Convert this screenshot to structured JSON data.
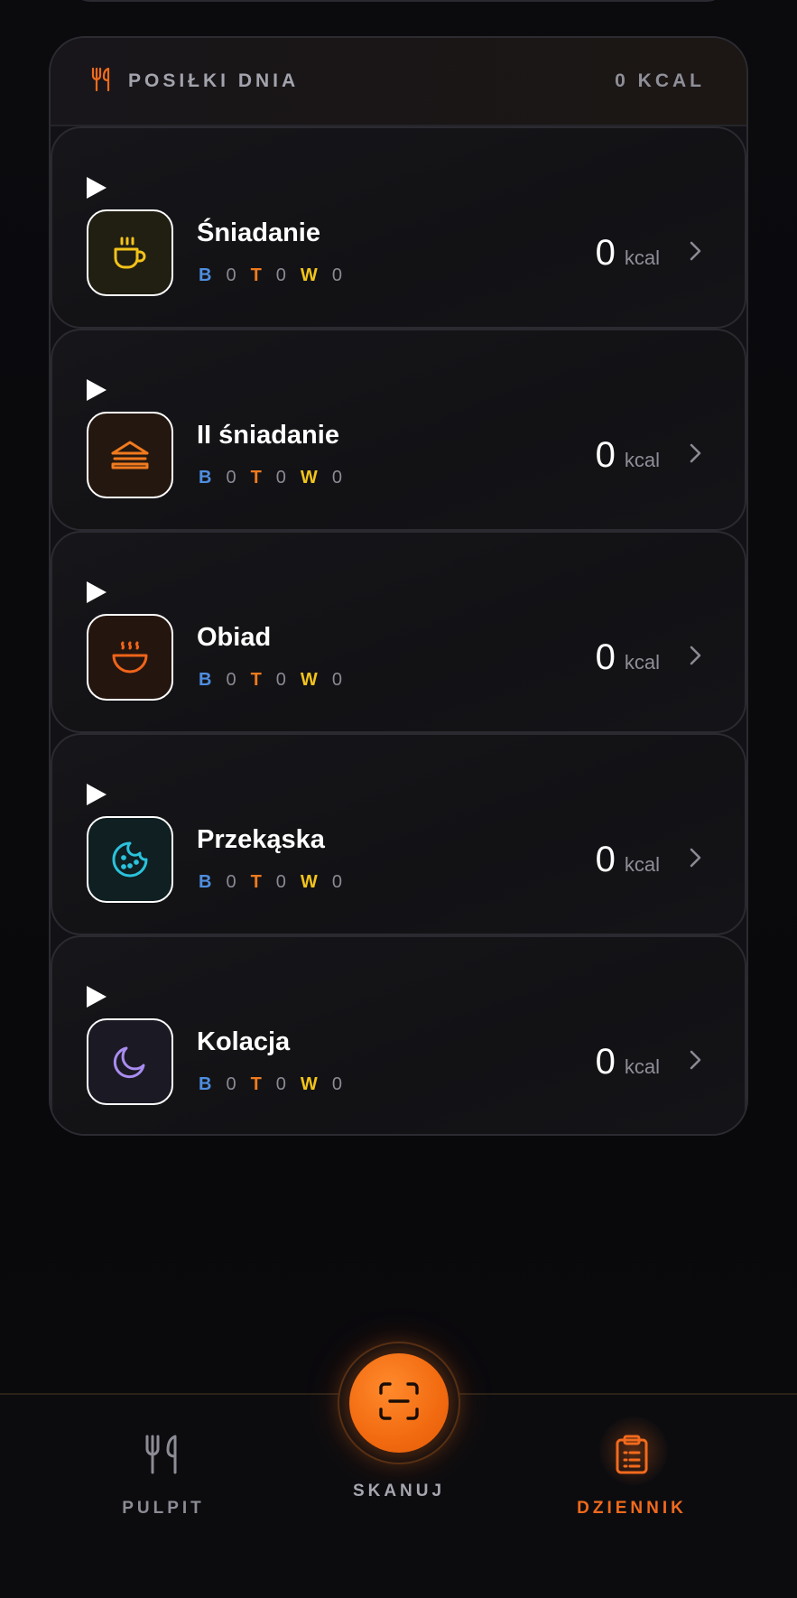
{
  "meals_section": {
    "title": "POSIŁKI DNIA",
    "total": "0 KCAL",
    "icon": "fork-knife-icon"
  },
  "meals": [
    {
      "name": "Śniadanie",
      "icon": "coffee-cup-icon",
      "kcal": "0",
      "unit": "kcal",
      "b_label": "B",
      "b": "0",
      "t_label": "T",
      "t": "0",
      "w_label": "W",
      "w": "0",
      "color": "#f2c31a"
    },
    {
      "name": "II śniadanie",
      "icon": "sandwich-icon",
      "kcal": "0",
      "unit": "kcal",
      "b_label": "B",
      "b": "0",
      "t_label": "T",
      "t": "0",
      "w_label": "W",
      "w": "0",
      "color": "#f07a1e"
    },
    {
      "name": "Obiad",
      "icon": "soup-bowl-icon",
      "kcal": "0",
      "unit": "kcal",
      "b_label": "B",
      "b": "0",
      "t_label": "T",
      "t": "0",
      "w_label": "W",
      "w": "0",
      "color": "#f0641a"
    },
    {
      "name": "Przekąska",
      "icon": "cookie-icon",
      "kcal": "0",
      "unit": "kcal",
      "b_label": "B",
      "b": "0",
      "t_label": "T",
      "t": "0",
      "w_label": "W",
      "w": "0",
      "color": "#2bc2dc"
    },
    {
      "name": "Kolacja",
      "icon": "moon-icon",
      "kcal": "0",
      "unit": "kcal",
      "b_label": "B",
      "b": "0",
      "t_label": "T",
      "t": "0",
      "w_label": "W",
      "w": "0",
      "color": "#a98cf0"
    }
  ],
  "nav": {
    "pulpit": "PULPIT",
    "skanuj": "SKANUJ",
    "dziennik": "DZIENNIK"
  },
  "colors": {
    "accent": "#f26a1c",
    "protein": "#4f8ee0",
    "fat": "#f07a1e",
    "carbs": "#f2c31a"
  }
}
